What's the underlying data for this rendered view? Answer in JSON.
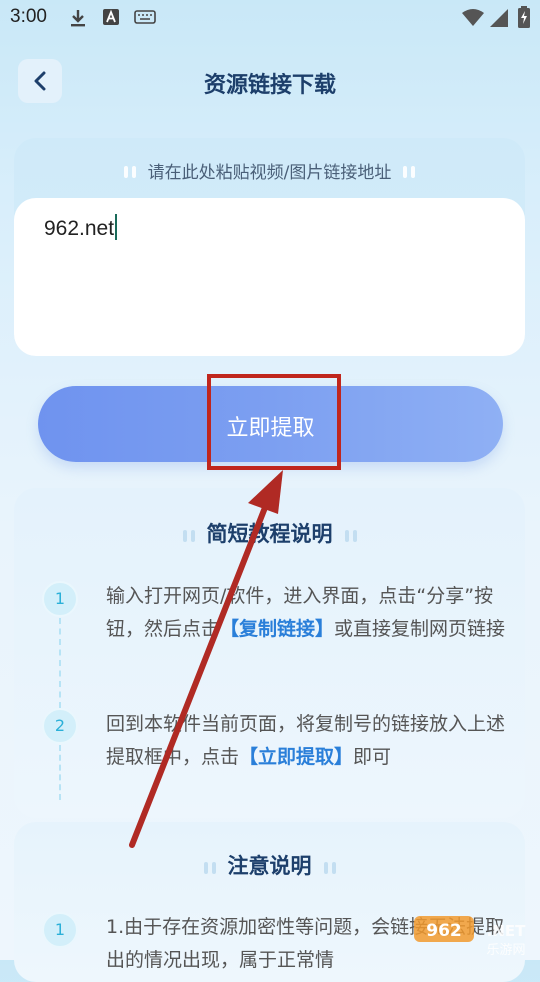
{
  "status_bar": {
    "time": "3:00"
  },
  "header": {
    "title": "资源链接下载"
  },
  "input_card": {
    "hint": "请在此处粘贴视频/图片链接地址",
    "value": "962.net"
  },
  "extract_button": {
    "label": "立即提取"
  },
  "tutorial": {
    "title": "简短教程说明",
    "steps": [
      {
        "num": "1",
        "pre": "输入打开网页/软件，进入界面，点击“分享”按钮，然后点击",
        "highlight": "【复制链接】",
        "post": "或直接复制网页链接"
      },
      {
        "num": "2",
        "pre": "回到本软件当前页面，将复制号的链接放入上述提取框中，点击",
        "highlight": "【立即提取】",
        "post": "即可"
      }
    ]
  },
  "notice": {
    "title": "注意说明",
    "items": [
      {
        "num": "1",
        "text": "1.由于存在资源加密性等问题，会链接无法提取出的情况出现，属于正常情"
      }
    ]
  },
  "watermark": {
    "logo": "962.NET",
    "site": "乐游网"
  },
  "colors": {
    "accent": "#2a7fd9",
    "button": "#7c9ff1",
    "annotation": "#c0261d",
    "title": "#1d3f6b"
  }
}
